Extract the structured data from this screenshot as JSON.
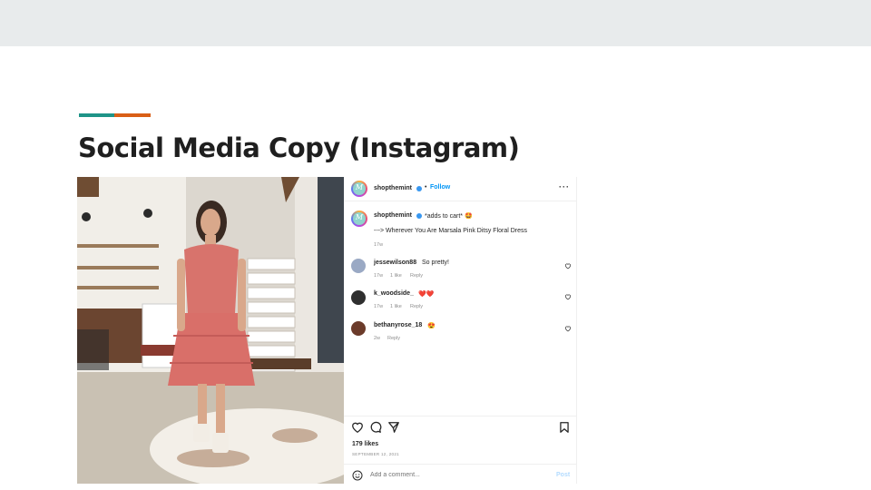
{
  "slide": {
    "title": "Social Media Copy (Instagram)",
    "accent_colors": [
      "#1f9488",
      "#d95f16"
    ]
  },
  "photo": {
    "description_icon": "photo-of-woman-in-pink-floral-dress"
  },
  "instagram": {
    "header": {
      "username": "shopthemint",
      "separator": "•",
      "follow_label": "Follow",
      "more_label": "···",
      "avatar_monogram": "M"
    },
    "caption": {
      "username": "shopthemint",
      "text": "*adds to cart* 🤩",
      "body": "---> Wherever You Are Marsala Pink Ditsy Floral Dress",
      "time": "17w"
    },
    "comments": [
      {
        "username": "jessewilson88",
        "text": "So pretty!",
        "time": "17w",
        "likes": "1 like",
        "reply": "Reply"
      },
      {
        "username": "k_woodside_",
        "text": "❤️❤️",
        "time": "17w",
        "likes": "1 like",
        "reply": "Reply"
      },
      {
        "username": "bethanyrose_18",
        "text": "😍",
        "time": "2w",
        "likes": "",
        "reply": "Reply"
      }
    ],
    "likes_count": "179 likes",
    "date": "SEPTEMBER 12, 2021",
    "add_comment_placeholder": "Add a comment...",
    "post_label": "Post",
    "colors": {
      "link_blue": "#0095f6",
      "muted": "#8e8e8e",
      "post_disabled": "#b3dbff"
    }
  }
}
